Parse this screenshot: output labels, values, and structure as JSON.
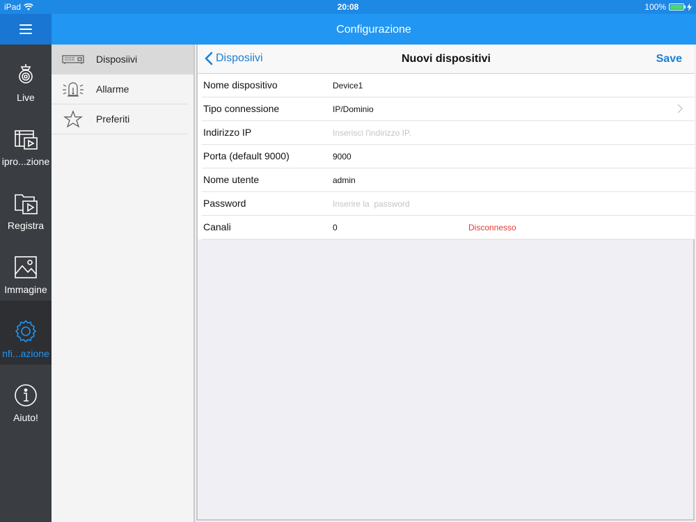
{
  "status_bar": {
    "device": "iPad",
    "time": "20:08",
    "battery": "100%",
    "battery_level": 1.0
  },
  "header": {
    "title": "Configurazione"
  },
  "tabs": [
    {
      "label": "Live",
      "icon": "camera-icon"
    },
    {
      "label": "ipro...zione",
      "icon": "playback-icon"
    },
    {
      "label": "Registra",
      "icon": "record-folder-icon"
    },
    {
      "label": "Immagine",
      "icon": "image-icon"
    },
    {
      "label": "nfi...azione",
      "icon": "gear-icon"
    },
    {
      "label": "Aiuto!",
      "icon": "info-icon"
    }
  ],
  "active_tab": 4,
  "submenu": [
    {
      "label": "Disposiivi",
      "icon": "dvr-device-icon"
    },
    {
      "label": "Allarme",
      "icon": "alarm-light-icon"
    },
    {
      "label": "Preferiti",
      "icon": "star-icon"
    }
  ],
  "detail": {
    "back_label": "Disposiivi",
    "title": "Nuovi dispositivi",
    "save_label": "Save",
    "fields": {
      "device_name": {
        "label": "Nome dispositivo",
        "value": "Device1"
      },
      "connection_type": {
        "label": "Tipo connessione",
        "value": "IP/Dominio"
      },
      "ip_address": {
        "label": "Indirizzo IP",
        "value": "",
        "placeholder": "Inserisci l'indirizzo IP."
      },
      "port": {
        "label": "Porta (default 9000)",
        "value": "9000"
      },
      "username": {
        "label": "Nome utente",
        "value": "admin"
      },
      "password": {
        "label": "Password",
        "value": "",
        "placeholder": "Inserire la  password"
      },
      "channels": {
        "label": "Canali",
        "value": "0",
        "status": "Disconnesso"
      }
    }
  },
  "colors": {
    "accent": "#2196f3",
    "link": "#1a7fd4",
    "error": "#e53935",
    "sidebar": "#3a3d42"
  }
}
